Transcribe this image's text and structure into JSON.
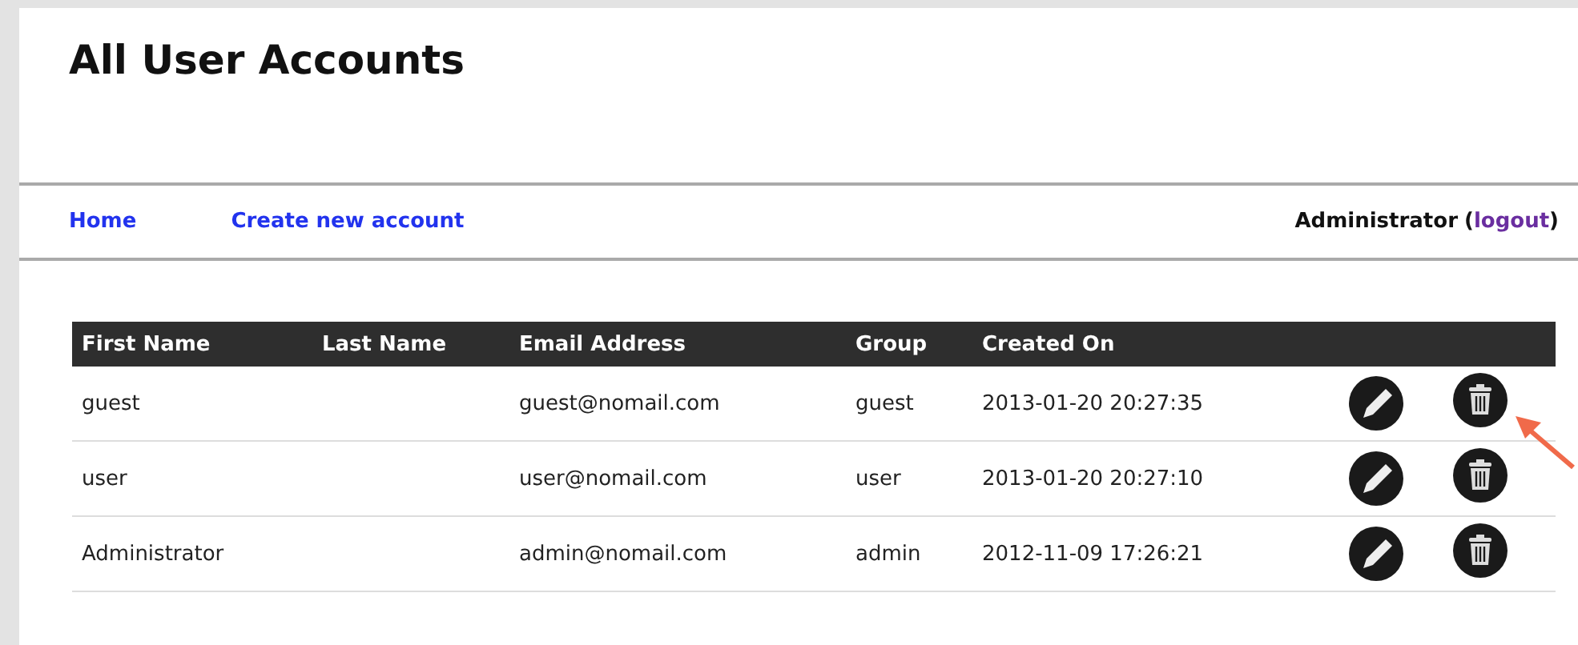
{
  "title": "All User Accounts",
  "nav": {
    "links": [
      "Home",
      "Create new account"
    ],
    "user": "Administrator",
    "open_paren": "(",
    "logout": "logout",
    "close_paren": ")"
  },
  "table": {
    "columns": [
      "First Name",
      "Last Name",
      "Email Address",
      "Group",
      "Created On"
    ],
    "rows": [
      {
        "first_name": "guest",
        "email": "guest@nomail.com",
        "group": "guest",
        "created_on": "2013-01-20 20:27:35",
        "annotated": true
      },
      {
        "first_name": "user",
        "email": "user@nomail.com",
        "group": "user",
        "created_on": "2013-01-20 20:27:10",
        "annotated": false
      },
      {
        "first_name": "Administrator",
        "email": "admin@nomail.com",
        "group": "admin",
        "created_on": "2012-11-09 17:26:21",
        "annotated": false
      }
    ]
  }
}
